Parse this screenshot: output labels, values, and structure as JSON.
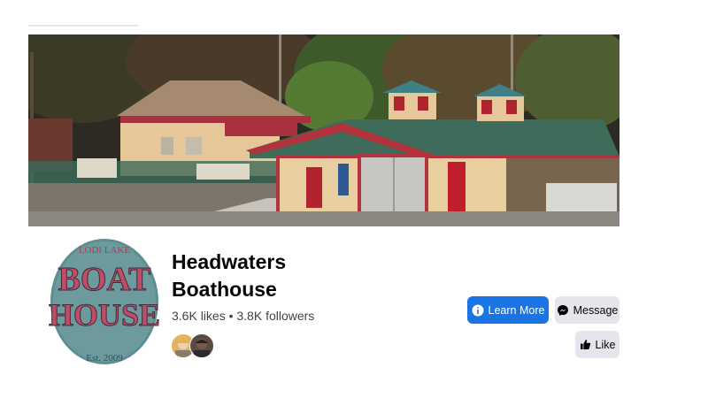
{
  "page": {
    "name": "Headwaters Boathouse",
    "stats": "3.6K likes • 3.8K followers"
  },
  "profile": {
    "logo_text_top": "LODI LAKE",
    "logo_text_line1": "BOAT",
    "logo_text_line2": "HOUSE",
    "logo_text_est": "Est. 2009"
  },
  "buttons": {
    "learn_more": "Learn More",
    "message": "Message",
    "like": "Like"
  },
  "icons": {
    "learn_more": "info-icon",
    "message": "messenger-icon",
    "like": "thumbs-up-icon"
  },
  "colors": {
    "primary": "#1b74e4",
    "secondary_button": "#e4e6eb"
  }
}
